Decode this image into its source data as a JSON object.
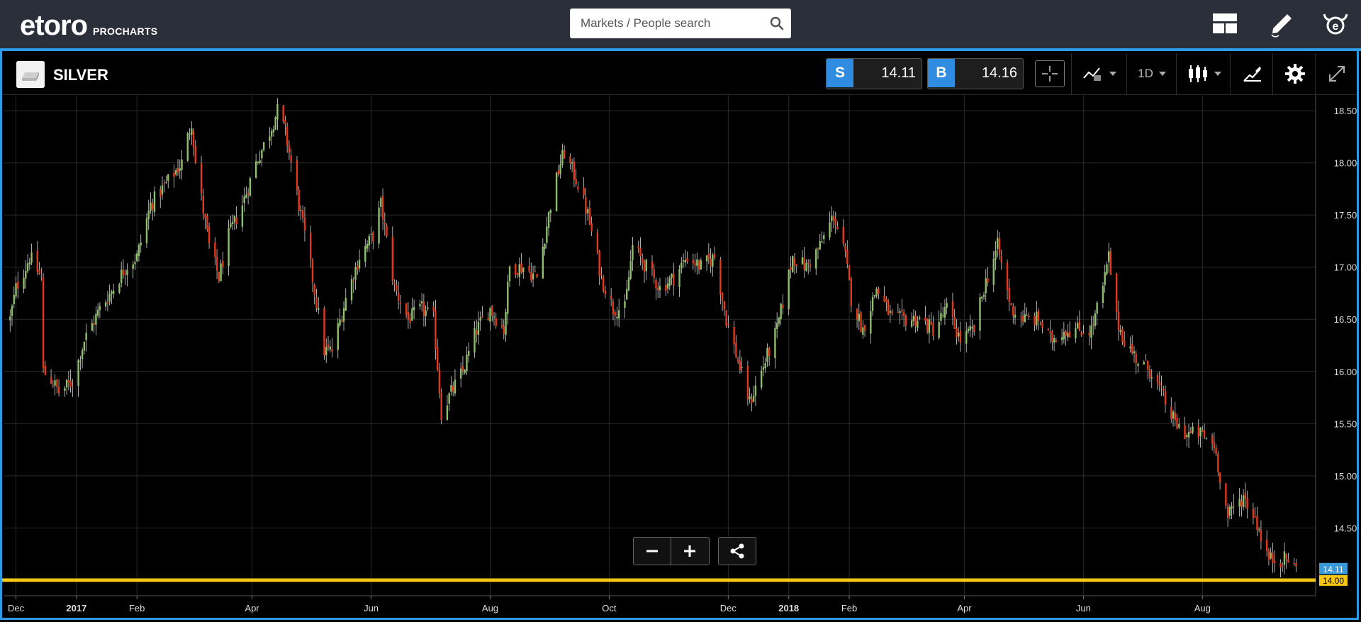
{
  "app": {
    "logo_text": "etoro",
    "logo_sub": "PROCHARTS",
    "search_placeholder": "Markets / People search"
  },
  "instrument": {
    "name": "SILVER",
    "sell_label": "S",
    "sell_price": "14.11",
    "buy_label": "B",
    "buy_price": "14.16"
  },
  "toolbar": {
    "interval": "1D"
  },
  "icons": {
    "search": "search-icon",
    "layout": "layout-icon",
    "edit": "pencil-icon",
    "profile": "etoro-bull-icon",
    "crosshair": "crosshair-icon",
    "indicators": "indicators-icon",
    "chart_type": "candlestick-icon",
    "drawing": "drawing-tools-icon",
    "settings": "gear-icon",
    "fullscreen": "expand-icon",
    "zoom_out": "minus-icon",
    "zoom_in": "plus-icon",
    "share": "share-icon"
  },
  "colors": {
    "topbar": "#2b2f3a",
    "accent": "#2f9ae4",
    "up_candle": "#8fbf6a",
    "down_candle": "#e2391b",
    "horizontal_line": "#f5c518",
    "bid_tag": "#3a9ad9"
  },
  "chart_data": {
    "type": "candlestick",
    "instrument": "SILVER",
    "interval": "1D",
    "yticks": [
      "18.50",
      "18.00",
      "17.50",
      "17.00",
      "16.50",
      "16.00",
      "15.50",
      "15.00",
      "14.50"
    ],
    "ylim": [
      13.85,
      18.65
    ],
    "xticks": [
      "Dec",
      "2017",
      "Feb",
      "Apr",
      "Jun",
      "Aug",
      "Oct",
      "Dec",
      "2018",
      "Feb",
      "Apr",
      "Jun",
      "Aug"
    ],
    "xrange": [
      "2016-11-25",
      "2018-09-28"
    ],
    "xtick_dates": [
      "2016-12-01",
      "2017-01-01",
      "2017-02-01",
      "2017-04-01",
      "2017-06-01",
      "2017-08-01",
      "2017-10-01",
      "2017-12-01",
      "2018-01-01",
      "2018-02-01",
      "2018-04-01",
      "2018-06-01",
      "2018-08-01"
    ],
    "close_path": [
      [
        "2016-11-28",
        16.5
      ],
      [
        "2016-12-01",
        16.8
      ],
      [
        "2016-12-06",
        17.0
      ],
      [
        "2016-12-08",
        17.1
      ],
      [
        "2016-12-14",
        16.9
      ],
      [
        "2016-12-15",
        16.0
      ],
      [
        "2016-12-20",
        15.9
      ],
      [
        "2016-12-23",
        15.8
      ],
      [
        "2016-12-30",
        15.9
      ],
      [
        "2017-01-05",
        16.3
      ],
      [
        "2017-01-13",
        16.6
      ],
      [
        "2017-01-20",
        16.8
      ],
      [
        "2017-01-26",
        17.0
      ],
      [
        "2017-02-01",
        17.1
      ],
      [
        "2017-02-08",
        17.6
      ],
      [
        "2017-02-16",
        17.8
      ],
      [
        "2017-02-24",
        18.0
      ],
      [
        "2017-03-01",
        18.4
      ],
      [
        "2017-03-03",
        18.0
      ],
      [
        "2017-03-10",
        17.2
      ],
      [
        "2017-03-15",
        16.9
      ],
      [
        "2017-03-20",
        17.3
      ],
      [
        "2017-03-27",
        17.6
      ],
      [
        "2017-04-03",
        18.0
      ],
      [
        "2017-04-10",
        18.3
      ],
      [
        "2017-04-14",
        18.5
      ],
      [
        "2017-04-18",
        18.3
      ],
      [
        "2017-04-24",
        17.7
      ],
      [
        "2017-05-01",
        17.0
      ],
      [
        "2017-05-08",
        16.2
      ],
      [
        "2017-05-12",
        16.2
      ],
      [
        "2017-05-19",
        16.7
      ],
      [
        "2017-05-26",
        17.1
      ],
      [
        "2017-06-02",
        17.3
      ],
      [
        "2017-06-06",
        17.6
      ],
      [
        "2017-06-13",
        16.8
      ],
      [
        "2017-06-20",
        16.5
      ],
      [
        "2017-06-27",
        16.6
      ],
      [
        "2017-07-03",
        16.5
      ],
      [
        "2017-07-07",
        15.6
      ],
      [
        "2017-07-12",
        15.8
      ],
      [
        "2017-07-18",
        16.0
      ],
      [
        "2017-07-25",
        16.4
      ],
      [
        "2017-08-01",
        16.6
      ],
      [
        "2017-08-08",
        16.4
      ],
      [
        "2017-08-11",
        17.0
      ],
      [
        "2017-08-18",
        17.0
      ],
      [
        "2017-08-25",
        16.9
      ],
      [
        "2017-09-01",
        17.6
      ],
      [
        "2017-09-06",
        18.0
      ],
      [
        "2017-09-08",
        18.1
      ],
      [
        "2017-09-15",
        17.8
      ],
      [
        "2017-09-20",
        17.5
      ],
      [
        "2017-09-27",
        16.9
      ],
      [
        "2017-10-03",
        16.6
      ],
      [
        "2017-10-09",
        16.6
      ],
      [
        "2017-10-13",
        17.2
      ],
      [
        "2017-10-20",
        17.0
      ],
      [
        "2017-10-27",
        16.8
      ],
      [
        "2017-11-03",
        16.9
      ],
      [
        "2017-11-10",
        17.1
      ],
      [
        "2017-11-17",
        17.0
      ],
      [
        "2017-11-24",
        17.1
      ],
      [
        "2017-11-30",
        16.5
      ],
      [
        "2017-12-06",
        16.1
      ],
      [
        "2017-12-12",
        15.7
      ],
      [
        "2017-12-18",
        16.0
      ],
      [
        "2017-12-26",
        16.4
      ],
      [
        "2018-01-03",
        17.1
      ],
      [
        "2018-01-10",
        17.0
      ],
      [
        "2018-01-17",
        17.2
      ],
      [
        "2018-01-24",
        17.5
      ],
      [
        "2018-01-30",
        17.1
      ],
      [
        "2018-02-02",
        16.7
      ],
      [
        "2018-02-08",
        16.4
      ],
      [
        "2018-02-15",
        16.8
      ],
      [
        "2018-02-23",
        16.5
      ],
      [
        "2018-03-02",
        16.5
      ],
      [
        "2018-03-09",
        16.5
      ],
      [
        "2018-03-16",
        16.4
      ],
      [
        "2018-03-23",
        16.6
      ],
      [
        "2018-03-30",
        16.3
      ],
      [
        "2018-04-06",
        16.4
      ],
      [
        "2018-04-11",
        16.8
      ],
      [
        "2018-04-18",
        17.2
      ],
      [
        "2018-04-25",
        16.6
      ],
      [
        "2018-05-02",
        16.5
      ],
      [
        "2018-05-09",
        16.5
      ],
      [
        "2018-05-15",
        16.3
      ],
      [
        "2018-05-22",
        16.4
      ],
      [
        "2018-05-29",
        16.4
      ],
      [
        "2018-06-05",
        16.4
      ],
      [
        "2018-06-11",
        16.8
      ],
      [
        "2018-06-14",
        17.1
      ],
      [
        "2018-06-18",
        16.5
      ],
      [
        "2018-06-22",
        16.3
      ],
      [
        "2018-06-29",
        16.1
      ],
      [
        "2018-07-06",
        16.0
      ],
      [
        "2018-07-13",
        15.7
      ],
      [
        "2018-07-18",
        15.5
      ],
      [
        "2018-07-24",
        15.4
      ],
      [
        "2018-07-31",
        15.4
      ],
      [
        "2018-08-07",
        15.3
      ],
      [
        "2018-08-10",
        15.0
      ],
      [
        "2018-08-14",
        14.6
      ],
      [
        "2018-08-17",
        14.7
      ],
      [
        "2018-08-22",
        14.8
      ],
      [
        "2018-08-28",
        14.6
      ],
      [
        "2018-09-04",
        14.2
      ],
      [
        "2018-09-10",
        14.2
      ],
      [
        "2018-09-14",
        14.2
      ],
      [
        "2018-09-18",
        14.1
      ]
    ],
    "last_bid": "14.11",
    "horizontal_line": {
      "value": "14.00",
      "color": "#f5c518"
    },
    "grid": true,
    "price_axis": "right"
  }
}
